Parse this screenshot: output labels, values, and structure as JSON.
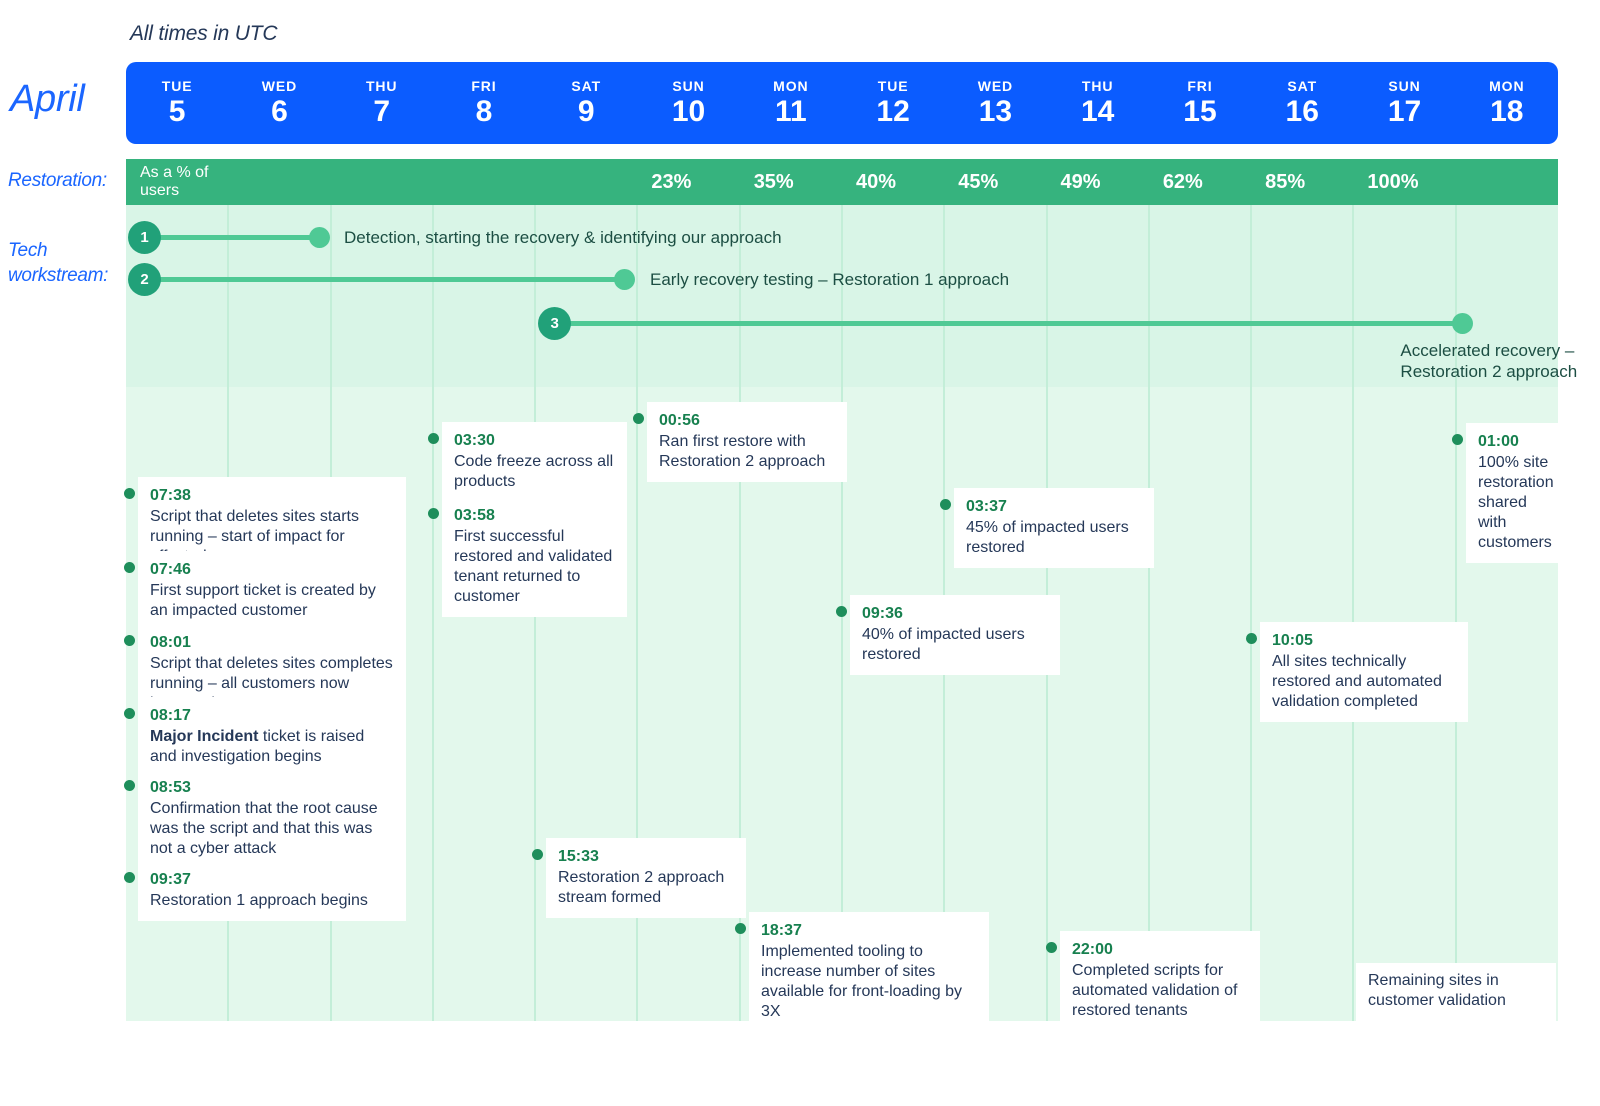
{
  "header": {
    "utc_note": "All times in UTC",
    "month_label": "April",
    "restoration_label": "Restoration:",
    "tech_label": "Tech\nworkstream:",
    "pct_note": "As a % of users"
  },
  "days": [
    {
      "dow": "TUE",
      "num": "5",
      "pct": ""
    },
    {
      "dow": "WED",
      "num": "6",
      "pct": ""
    },
    {
      "dow": "THU",
      "num": "7",
      "pct": ""
    },
    {
      "dow": "FRI",
      "num": "8",
      "pct": ""
    },
    {
      "dow": "SAT",
      "num": "9",
      "pct": ""
    },
    {
      "dow": "SUN",
      "num": "10",
      "pct": "23%"
    },
    {
      "dow": "MON",
      "num": "11",
      "pct": "35%"
    },
    {
      "dow": "TUE",
      "num": "12",
      "pct": "40%"
    },
    {
      "dow": "WED",
      "num": "13",
      "pct": "45%"
    },
    {
      "dow": "THU",
      "num": "14",
      "pct": "49%"
    },
    {
      "dow": "FRI",
      "num": "15",
      "pct": "62%"
    },
    {
      "dow": "SAT",
      "num": "16",
      "pct": "85%"
    },
    {
      "dow": "SUN",
      "num": "17",
      "pct": "100%"
    },
    {
      "dow": "MON",
      "num": "18",
      "pct": ""
    }
  ],
  "workstreams": [
    {
      "number": "1",
      "label": "Detection, starting the recovery & identifying our approach"
    },
    {
      "number": "2",
      "label": "Early recovery testing – Restoration 1 approach"
    },
    {
      "number": "3",
      "label": "Accelerated recovery –\nRestoration 2 approach"
    }
  ],
  "events": [
    {
      "time": "07:38",
      "desc": "Script that deletes sites starts running – start of impact for affected users"
    },
    {
      "time": "07:46",
      "desc": "First support ticket is created by an impacted customer"
    },
    {
      "time": "08:01",
      "desc": "Script that deletes sites completes running – all customers now impacted"
    },
    {
      "time": "08:17",
      "desc_bold": "Major Incident",
      "desc": " ticket is raised and investigation begins"
    },
    {
      "time": "08:53",
      "desc": "Confirmation that the root cause was the script and that this was not a cyber attack"
    },
    {
      "time": "09:37",
      "desc": "Restoration 1 approach begins"
    },
    {
      "time": "03:30",
      "desc": "Code freeze across all products"
    },
    {
      "time": "03:58",
      "desc": "First successful restored and validated tenant returned to customer"
    },
    {
      "time": "15:33",
      "desc": "Restoration 2 approach stream formed"
    },
    {
      "time": "00:56",
      "desc": "Ran first restore with Restoration 2 approach"
    },
    {
      "time": "18:37",
      "desc": "Implemented tooling to increase number of sites available for front-loading by 3X"
    },
    {
      "time": "09:36",
      "desc": "40% of impacted users restored"
    },
    {
      "time": "03:37",
      "desc": "45% of impacted users restored"
    },
    {
      "time": "22:00",
      "desc": "Completed scripts for automated validation of restored tenants"
    },
    {
      "time": "10:05",
      "desc": "All sites technically restored and automated validation completed"
    },
    {
      "time": "01:00",
      "desc": "100% site restoration shared with customers"
    },
    {
      "time": "",
      "desc": "Remaining sites in customer validation"
    }
  ],
  "colors": {
    "brand_blue": "#0B5CFF",
    "accent_green": "#36B37E",
    "bar_green": "#4FC995",
    "badge_green": "#21A179",
    "body_bg": "#E3F8EC",
    "text_navy": "#253858"
  }
}
